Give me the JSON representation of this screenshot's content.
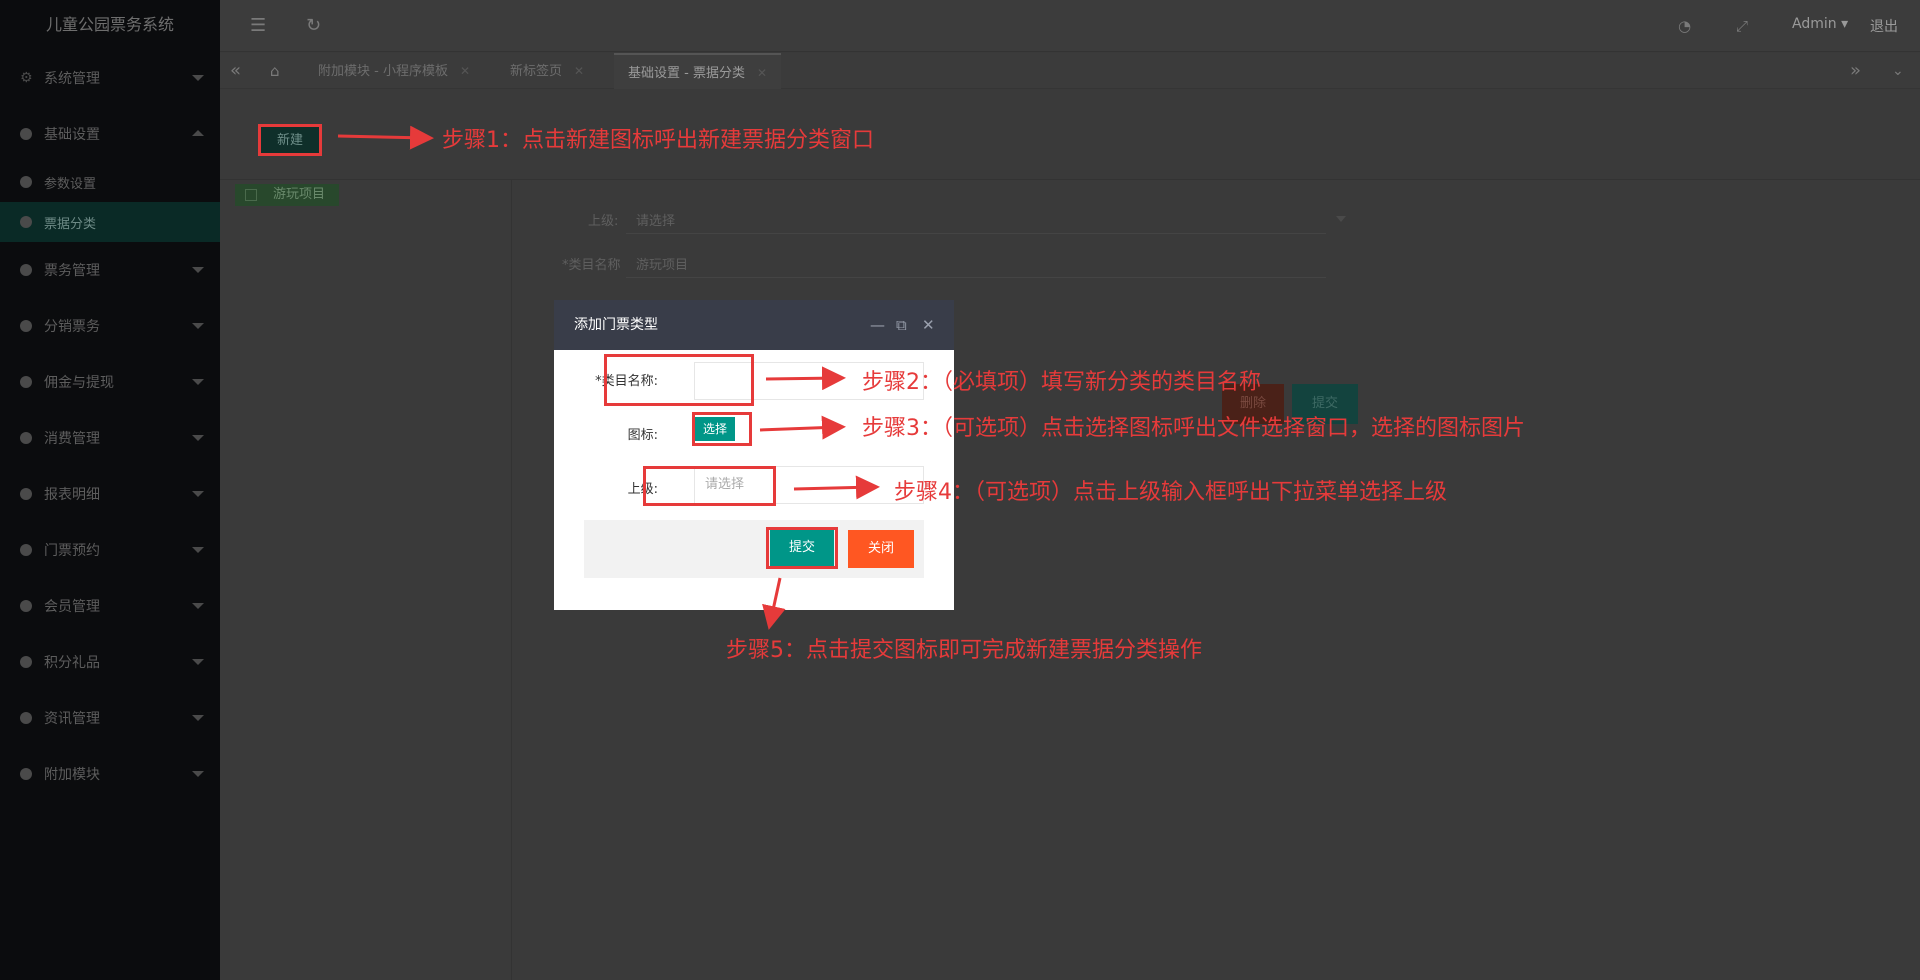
{
  "app": {
    "title": "儿童公园票务系统"
  },
  "sidebar": {
    "items": [
      {
        "label": "系统管理",
        "icon": "gear-icon"
      },
      {
        "label": "基础设置",
        "expanded": true
      },
      {
        "label": "票务管理"
      },
      {
        "label": "分销票务"
      },
      {
        "label": "佣金与提现"
      },
      {
        "label": "消费管理"
      },
      {
        "label": "报表明细"
      },
      {
        "label": "门票预约"
      },
      {
        "label": "会员管理"
      },
      {
        "label": "积分礼品"
      },
      {
        "label": "资讯管理"
      },
      {
        "label": "附加模块"
      }
    ],
    "sub_items": [
      {
        "label": "参数设置"
      },
      {
        "label": "票据分类",
        "active": true
      }
    ]
  },
  "header": {
    "user": "Admin",
    "logout": "退出"
  },
  "tabs": [
    {
      "label": "附加模块 - 小程序模板"
    },
    {
      "label": "新标签页"
    },
    {
      "label": "基础设置 - 票据分类",
      "active": true
    }
  ],
  "toolbar": {
    "new_label": "新建"
  },
  "tree": {
    "node_label": "游玩项目"
  },
  "bg_form": {
    "parent_label": "上级:",
    "parent_placeholder": "请选择",
    "name_label": "*类目名称",
    "name_value": "游玩项目",
    "delete_label": "删除",
    "submit_label": "提交"
  },
  "modal": {
    "title": "添加门票类型",
    "name_label": "*类目名称:",
    "icon_label": "图标:",
    "select_label": "选择",
    "parent_label": "上级:",
    "parent_placeholder": "请选择",
    "submit_label": "提交",
    "close_label": "关闭"
  },
  "steps": {
    "s1": "步骤1：点击新建图标呼出新建票据分类窗口",
    "s2": "步骤2：（必填项）填写新分类的类目名称",
    "s3": "步骤3：（可选项）点击选择图标呼出文件选择窗口，选择的图标图片",
    "s4": "步骤4：（可选项）点击上级输入框呼出下拉菜单选择上级",
    "s5": "步骤5：点击提交图标即可完成新建票据分类操作"
  },
  "colors": {
    "accent": "#009688",
    "danger": "#ff5722",
    "annotation": "#e63a3a",
    "modal_header": "#393d49"
  }
}
